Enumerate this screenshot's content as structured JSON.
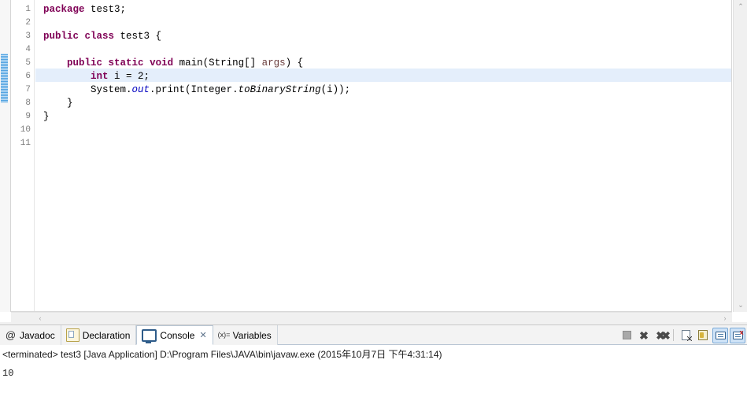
{
  "editor": {
    "line_numbers": [
      "1",
      "2",
      "3",
      "4",
      "5",
      "6",
      "7",
      "8",
      "9",
      "10",
      "11"
    ],
    "current_line": 6,
    "lines": [
      {
        "n": 1,
        "segments": [
          {
            "t": "package",
            "c": "kw"
          },
          {
            "t": " test3;",
            "c": "plain"
          }
        ]
      },
      {
        "n": 2,
        "segments": []
      },
      {
        "n": 3,
        "segments": [
          {
            "t": "public",
            "c": "kw"
          },
          {
            "t": " ",
            "c": "plain"
          },
          {
            "t": "class",
            "c": "kw"
          },
          {
            "t": " test3 {",
            "c": "plain"
          }
        ]
      },
      {
        "n": 4,
        "segments": []
      },
      {
        "n": 5,
        "segments": [
          {
            "t": "    ",
            "c": "plain"
          },
          {
            "t": "public",
            "c": "kw"
          },
          {
            "t": " ",
            "c": "plain"
          },
          {
            "t": "static",
            "c": "kw"
          },
          {
            "t": " ",
            "c": "plain"
          },
          {
            "t": "void",
            "c": "kw"
          },
          {
            "t": " main(String[] ",
            "c": "plain"
          },
          {
            "t": "args",
            "c": "param"
          },
          {
            "t": ") {",
            "c": "plain"
          }
        ]
      },
      {
        "n": 6,
        "segments": [
          {
            "t": "        ",
            "c": "plain"
          },
          {
            "t": "int",
            "c": "kw"
          },
          {
            "t": " i = 2;",
            "c": "plain"
          }
        ]
      },
      {
        "n": 7,
        "segments": [
          {
            "t": "        System.",
            "c": "plain"
          },
          {
            "t": "out",
            "c": "field"
          },
          {
            "t": ".print(Integer.",
            "c": "plain"
          },
          {
            "t": "toBinaryString",
            "c": "meth"
          },
          {
            "t": "(i));",
            "c": "plain"
          }
        ]
      },
      {
        "n": 8,
        "segments": [
          {
            "t": "    }",
            "c": "plain"
          }
        ]
      },
      {
        "n": 9,
        "segments": [
          {
            "t": "}",
            "c": "plain"
          }
        ]
      },
      {
        "n": 10,
        "segments": []
      },
      {
        "n": 11,
        "segments": []
      }
    ]
  },
  "scrollbars": {
    "v_up": "⌃",
    "v_down": "⌄",
    "h_left": "‹",
    "h_right": "›"
  },
  "bottom_view": {
    "tabs": [
      {
        "label": "Javadoc",
        "icon": "javadoc-icon",
        "glyph": "@",
        "active": false,
        "closable": false
      },
      {
        "label": "Declaration",
        "icon": "declaration-icon",
        "glyph": "",
        "active": false,
        "closable": false
      },
      {
        "label": "Console",
        "icon": "console-icon",
        "glyph": "",
        "active": true,
        "closable": true
      },
      {
        "label": "Variables",
        "icon": "variables-icon",
        "glyph": "(x)=",
        "active": false,
        "closable": false
      }
    ],
    "close_glyph": "✕",
    "toolbar": [
      {
        "name": "terminate-button",
        "kind": "terminate",
        "pressed": false
      },
      {
        "name": "remove-launch-button",
        "kind": "x",
        "glyph": "✖",
        "pressed": false
      },
      {
        "name": "remove-all-terminated-button",
        "kind": "xx",
        "glyph": "✖✖",
        "pressed": false
      },
      {
        "name": "separator",
        "kind": "sep",
        "pressed": false
      },
      {
        "name": "clear-console-button",
        "kind": "doc",
        "pressed": false
      },
      {
        "name": "scroll-lock-button",
        "kind": "lock",
        "pressed": false
      },
      {
        "name": "pin-console-button",
        "kind": "screen",
        "pressed": true
      },
      {
        "name": "display-selected-console-button",
        "kind": "screen-red",
        "pressed": true
      }
    ],
    "console": {
      "status_line": "<terminated> test3 [Java Application] D:\\Program Files\\JAVA\\bin\\javaw.exe (2015年10月7日 下午4:31:14)",
      "output": "10"
    }
  },
  "colors": {
    "keyword": "#7f0055",
    "field": "#0000c0",
    "parameter": "#6a3e3e",
    "current_line_highlight": "#e4eefb",
    "annotation_bar": "#4a9fe0",
    "tab_active_bg": "#ffffff",
    "toolbar_pressed_bg": "#cfe3f7"
  }
}
